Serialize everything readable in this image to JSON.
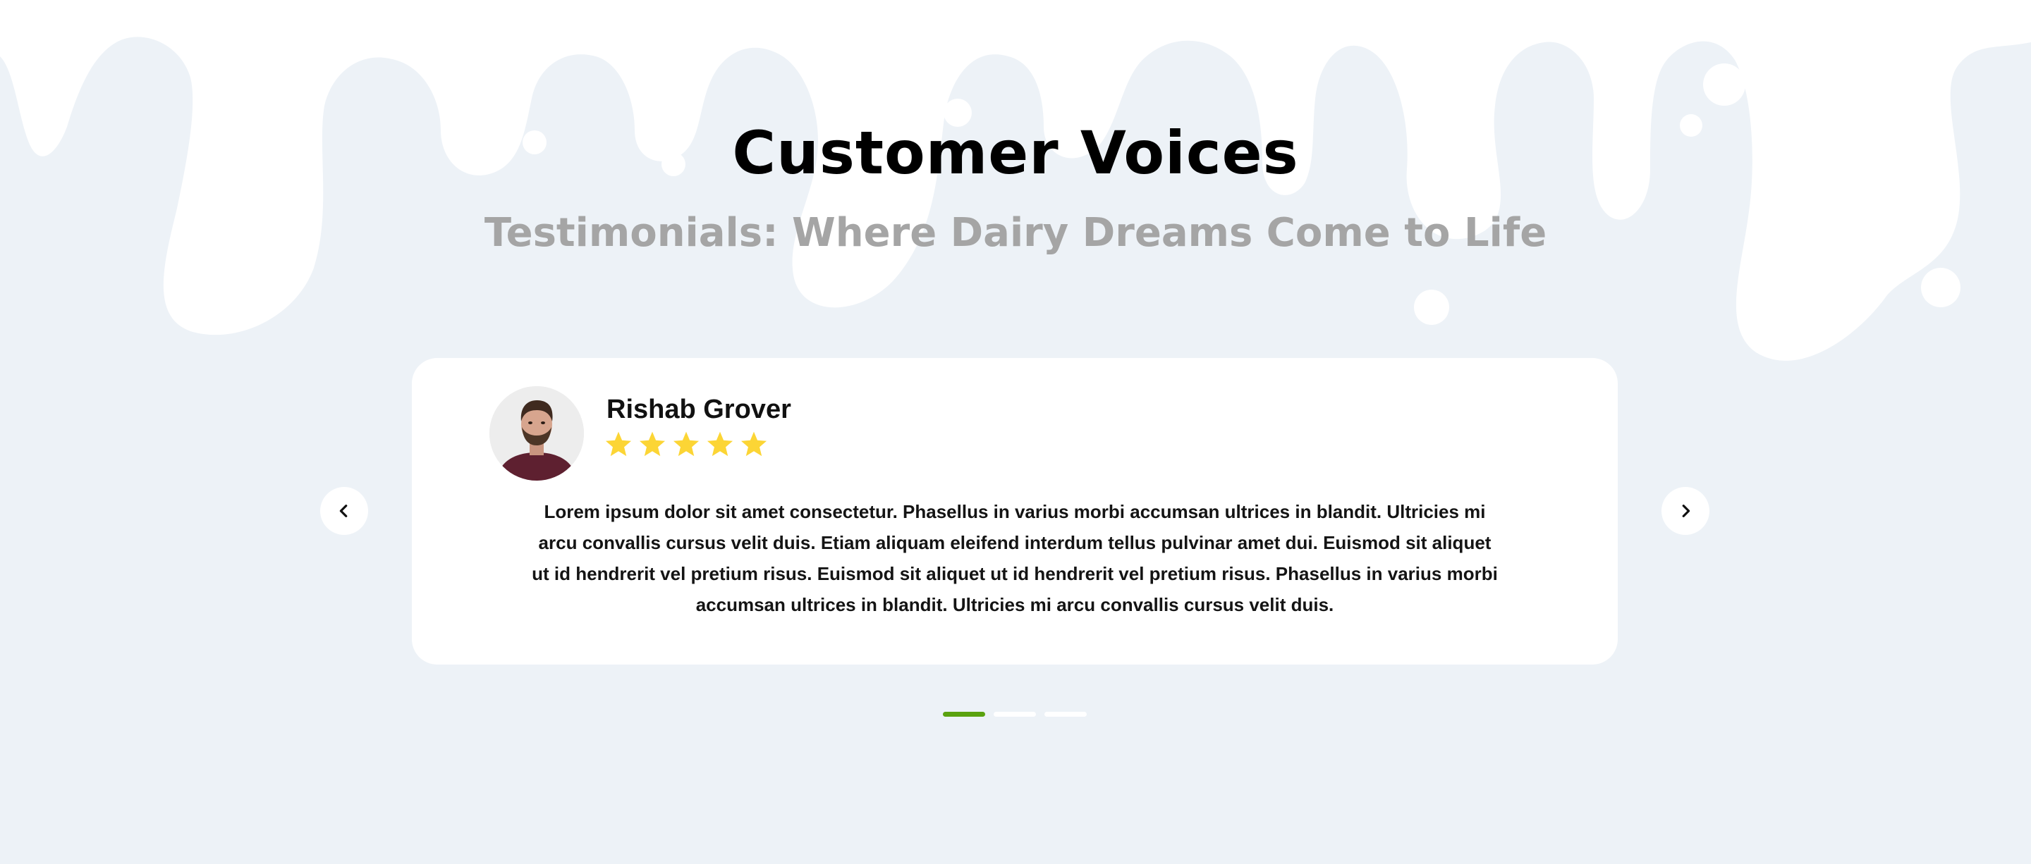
{
  "section": {
    "title": "Customer Voices",
    "subtitle": "Testimonials: Where Dairy Dreams Come to Life"
  },
  "testimonial": {
    "name": "Rishab Grover",
    "rating": 5,
    "rating_max": 5,
    "text": "Lorem ipsum dolor sit amet consectetur. Phasellus in varius morbi accumsan ultrices in blandit. Ultricies mi arcu convallis cursus velit duis. Etiam aliquam eleifend interdum tellus pulvinar amet dui. Euismod sit aliquet ut id hendrerit vel pretium risus. Euismod sit aliquet ut id hendrerit vel pretium risus.  Phasellus in varius morbi accumsan ultrices in blandit. Ultricies mi arcu convallis cursus velit duis."
  },
  "carousel": {
    "prev_icon": "chevron-left-icon",
    "next_icon": "chevron-right-icon",
    "slide_count": 3,
    "active_index": 0
  },
  "colors": {
    "background": "#edf2f7",
    "card": "#ffffff",
    "title": "#000000",
    "subtitle": "#a5a5a5",
    "star": "#fcd535",
    "active_dot": "#5aa20f",
    "inactive_dot": "#ffffff"
  }
}
